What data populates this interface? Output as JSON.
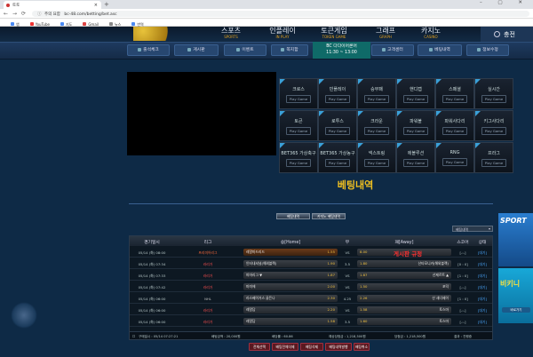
{
  "browser": {
    "tab_title": "토토",
    "url_prefix": "주의 요함",
    "url": "bc-48.com/betting/bet.asc",
    "bookmarks": [
      "앱",
      "YouTube",
      "지도",
      "Gmail",
      "뉴스",
      "번역"
    ]
  },
  "top_nav": [
    {
      "main": "스포츠",
      "sub": "SPORTS"
    },
    {
      "main": "인플레이",
      "sub": "IN PLAY"
    },
    {
      "main": "토큰게임",
      "sub": "TOKEN GAME"
    },
    {
      "main": "그래프",
      "sub": "GRAPH"
    },
    {
      "main": "카지노",
      "sub": "CASINO"
    }
  ],
  "charge_label": "충전",
  "menu": [
    "출석체크",
    "게시판",
    "이벤트",
    "쪽지함",
    "고객센터",
    "베팅내역",
    "정보수정"
  ],
  "clock": {
    "line1": "BC 다다이어론어",
    "line2": "11:30 ~ 13:00"
  },
  "games": [
    {
      "name": "크로스",
      "btn": "Play Game"
    },
    {
      "name": "빈플레이",
      "btn": "Play Game"
    },
    {
      "name": "승무패",
      "btn": "Play Game"
    },
    {
      "name": "핸디캡",
      "btn": "Play Game"
    },
    {
      "name": "스페셜",
      "btn": "Play Game"
    },
    {
      "name": "실시간",
      "btn": "Play Game"
    },
    {
      "name": "토큰",
      "btn": "Play Game"
    },
    {
      "name": "로투스",
      "btn": "Play Game"
    },
    {
      "name": "크라운",
      "btn": "Play Game"
    },
    {
      "name": "파워볼",
      "btn": "Play Game"
    },
    {
      "name": "파워사다리",
      "btn": "Play Game"
    },
    {
      "name": "키그사다리",
      "btn": "Play Game"
    },
    {
      "name": "BET365 가상축구",
      "btn": "Play Game"
    },
    {
      "name": "BET365 가상농구",
      "btn": "Play Game"
    },
    {
      "name": "넥스트링",
      "btn": "Play Game"
    },
    {
      "name": "에볼루션",
      "btn": "Play Game"
    },
    {
      "name": "RNG",
      "btn": "Play Game"
    },
    {
      "name": "프라그",
      "btn": "Play Game"
    }
  ],
  "section_title": "베팅내역",
  "filter_buttons": [
    "베팅내역",
    "카지노 베팅내역"
  ],
  "select_value": "베팅내역",
  "table": {
    "headers": [
      "경기일시",
      "리그",
      "승[Home]",
      "무",
      "패[Away]",
      "스코어",
      "상태"
    ],
    "rows": [
      {
        "date": "05/14 (화) 08:00",
        "league": "프리미어리그",
        "home": "레알마드리드",
        "home_odd": "1.55",
        "draw": "VS",
        "away": "",
        "away_odd": "8.00",
        "score": "[-:-]",
        "status": "[대기]"
      },
      {
        "date": "05/14 (화) 07:34",
        "league": "라리가",
        "home": "인터내셔널(해외블랙)",
        "home_odd": "1.90",
        "draw": "3.5",
        "away": "산타모니카(해외블랙)",
        "away_odd": "1.80",
        "score": "[0 : 0]",
        "status": "[대기]"
      },
      {
        "date": "05/14 (화) 07:33",
        "league": "라리가",
        "home": "피마리그 ▼",
        "home_odd": "1.87",
        "draw": "VS",
        "away": "산제르트 ▲",
        "away_odd": "1.87",
        "score": "[1 : 0]",
        "status": "[대기]"
      },
      {
        "date": "05/14 (화) 07:42",
        "league": "라리가",
        "home": "마미에",
        "home_odd": "2.00",
        "draw": "VS",
        "away": "포덕",
        "away_odd": "1.50",
        "score": "[-:-]",
        "status": "[대기]"
      },
      {
        "date": "05/14 (화) 06:00",
        "league": "NHL",
        "home": "라스베이거스 골든나",
        "home_odd": "2.30",
        "draw": "4.25",
        "away": "산 새너제이",
        "away_odd": "2.26",
        "score": "[1 : 0]",
        "status": "[대기]"
      },
      {
        "date": "05/14 (화) 06:00",
        "league": "라리가",
        "home": "레알담",
        "home_odd": "2.20",
        "draw": "VS",
        "away": "토스마",
        "away_odd": "1.58",
        "score": "[-:-]",
        "status": "[대기]"
      },
      {
        "date": "05/14 (화) 06:00",
        "league": "라리가",
        "home": "레알담",
        "home_odd": "1.58",
        "draw": "3.5",
        "away": "토스마",
        "away_odd": "1.60",
        "score": "[-:-]",
        "status": "[대기]"
      }
    ],
    "footer": {
      "bet_time": "구매일시 : 05/14 07:27:21",
      "bet_amount": "배팅금액 : 20,000원",
      "bet_count": "배당률 : 60.86",
      "expected": "예상당첨금 : 1,218,500원",
      "win_amount": "당첨금 : 1,218,500원",
      "result": "결과 : 진행중"
    }
  },
  "notice": "게시판 규정",
  "bottom_buttons": [
    "전체선택",
    "배팅전체삭제",
    "배팅삭제",
    "배팅내역발행",
    "배팅취소"
  ],
  "banners": {
    "top": "SPORT",
    "bottom": "비키니",
    "bottom_btn": "바로가기"
  },
  "colors": {
    "accent_gold": "#f0c020",
    "notice_red": "#ff3030",
    "clock_bg": "#0f6a68"
  }
}
